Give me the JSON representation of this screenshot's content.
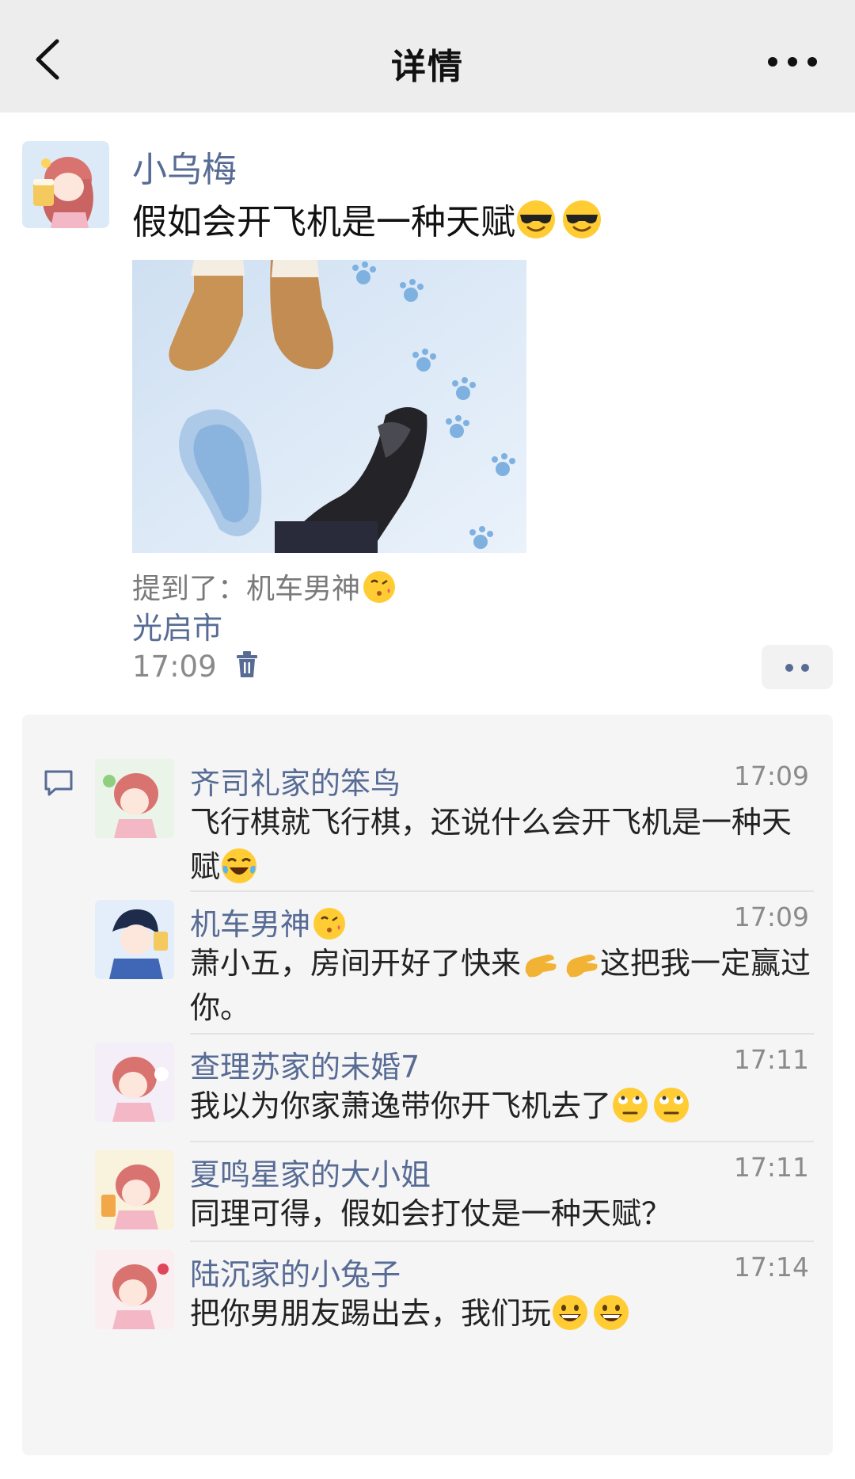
{
  "navbar": {
    "title": "详情"
  },
  "post": {
    "author": "小乌梅",
    "text": "假如会开飞机是一种天赋",
    "text_emojis": [
      "cool-sunglasses-emoji",
      "cool-sunglasses-emoji"
    ],
    "mention_prefix": "提到了：",
    "mention_name": "机车男神",
    "location": "光启市",
    "time": "17:09"
  },
  "comments": [
    {
      "name": "齐司礼家的笨鸟",
      "time": "17:09",
      "text": "飞行棋就飞行棋，还说什么会开飞机是一种天赋",
      "emoji": "tears-of-joy-emoji"
    },
    {
      "name": "机车男神",
      "time": "17:09",
      "text_a": "萧小五，房间开好了快来",
      "text_b": "这把我一定赢过你。",
      "emoji": "beckon-hand-emoji"
    },
    {
      "name": "查理苏家的未婚7",
      "time": "17:11",
      "text": "我以为你家萧逸带你开飞机去了",
      "emoji": "eye-roll-emoji"
    },
    {
      "name": "夏鸣星家的大小姐",
      "time": "17:11",
      "text": "同理可得，假如会打仗是一种天赋？"
    },
    {
      "name": "陆沉家的小兔子",
      "time": "17:14",
      "text": "把你男朋友踢出去，我们玩",
      "emoji": "grin-emoji"
    }
  ],
  "colors": {
    "link_blue": "#576b95",
    "nav_bg": "#ededed",
    "panel_bg": "#f5f5f5"
  }
}
